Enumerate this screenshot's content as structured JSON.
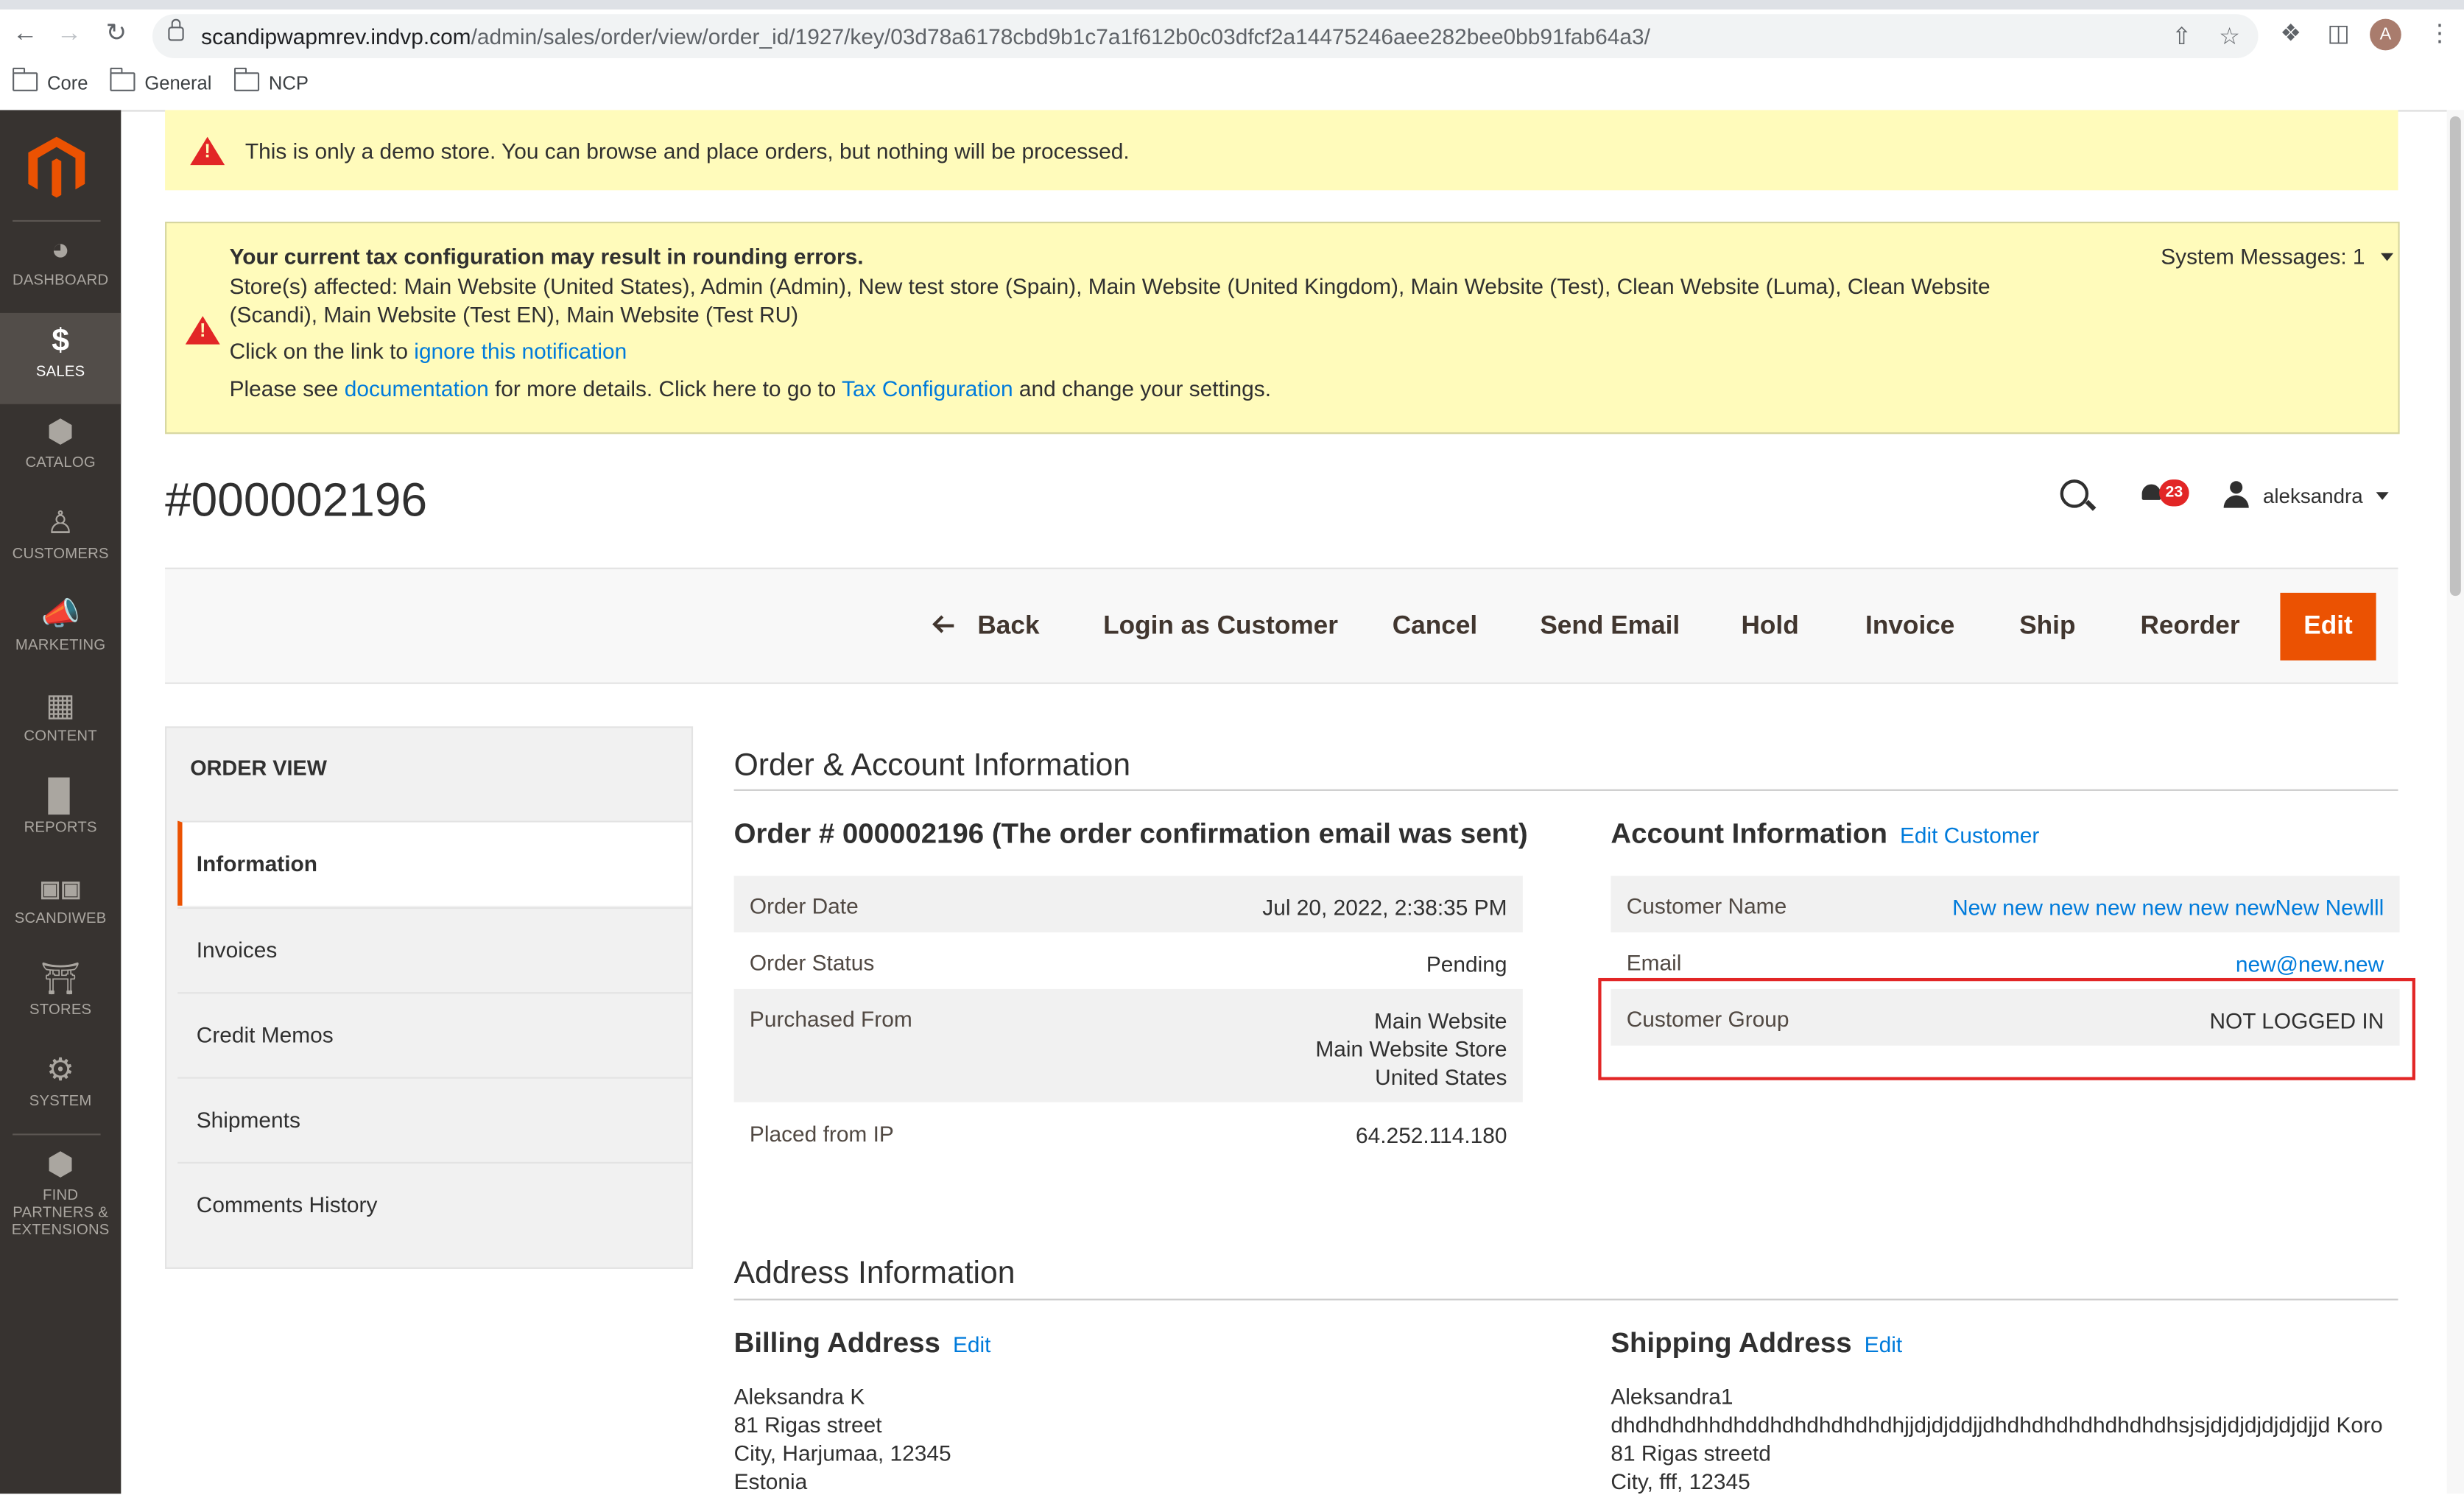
{
  "browser": {
    "url_host": "scandipwapmrev.indvp.com",
    "url_path": "/admin/sales/order/view/order_id/1927/key/03d78a6178cbd9b1c7a1f612b0c03dfcf2a14475246aee282bee0bb91fab64a3/",
    "profile_initial": "A",
    "bookmarks": [
      "Core",
      "General",
      "NCP"
    ]
  },
  "sidebar": {
    "items": [
      {
        "label": "DASHBOARD",
        "icon": "dashboard-icon"
      },
      {
        "label": "SALES",
        "icon": "dollar-icon"
      },
      {
        "label": "CATALOG",
        "icon": "cube-icon"
      },
      {
        "label": "CUSTOMERS",
        "icon": "person-icon"
      },
      {
        "label": "MARKETING",
        "icon": "megaphone-icon"
      },
      {
        "label": "CONTENT",
        "icon": "layout-icon"
      },
      {
        "label": "REPORTS",
        "icon": "bar-chart-icon"
      },
      {
        "label": "SCANDIWEB",
        "icon": "sw-logo-icon"
      },
      {
        "label": "STORES",
        "icon": "store-icon"
      },
      {
        "label": "SYSTEM",
        "icon": "gear-icon"
      },
      {
        "label": "FIND PARTNERS & EXTENSIONS",
        "icon": "boxes-icon"
      }
    ]
  },
  "messages": {
    "demo": "This is only a demo store. You can browse and place orders, but nothing will be processed.",
    "tax_title": "Your current tax configuration may result in rounding errors.",
    "tax_stores": "Store(s) affected: Main Website (United States), Admin (Admin), New test store (Spain), Main Website (United Kingdom), Main Website (Test), Clean Website (Luma), Clean Website (Scandi), Main Website (Test EN), Main Website (Test RU)",
    "click_prefix": "Click on the link to ",
    "ignore_link": "ignore this notification",
    "see_prefix": "Please see ",
    "doc_link": "documentation",
    "see_middle": " for more details. Click here to go to ",
    "tax_link": "Tax Configuration",
    "see_suffix": " and change your settings.",
    "system_messages": "System Messages: 1"
  },
  "header": {
    "title": "#000002196",
    "notifications": "23",
    "user": "aleksandra"
  },
  "actions": {
    "back": "Back",
    "login_as_customer": "Login as Customer",
    "cancel": "Cancel",
    "send_email": "Send Email",
    "hold": "Hold",
    "invoice": "Invoice",
    "ship": "Ship",
    "reorder": "Reorder",
    "edit": "Edit"
  },
  "tabs": {
    "title": "ORDER VIEW",
    "items": [
      "Information",
      "Invoices",
      "Credit Memos",
      "Shipments",
      "Comments History"
    ]
  },
  "order_account": {
    "section_title": "Order & Account Information",
    "order_title": "Order # 000002196 (The order confirmation email was sent)",
    "order_rows": [
      {
        "label": "Order Date",
        "value": "Jul 20, 2022, 2:38:35 PM"
      },
      {
        "label": "Order Status",
        "value": "Pending"
      },
      {
        "label": "Purchased From",
        "value_lines": [
          "Main Website",
          "Main Website Store",
          "United States"
        ]
      },
      {
        "label": "Placed from IP",
        "value": "64.252.114.180"
      }
    ],
    "account_title": "Account Information",
    "edit_customer": "Edit Customer",
    "account_rows": [
      {
        "label": "Customer Name",
        "value": "New new new new new new newNew Newlll"
      },
      {
        "label": "Email",
        "value": "new@new.new"
      },
      {
        "label": "Customer Group",
        "value": "NOT LOGGED IN"
      }
    ]
  },
  "address": {
    "section_title": "Address Information",
    "billing_title": "Billing Address",
    "billing_edit": "Edit",
    "billing_lines": [
      "Aleksandra K",
      "81 Rigas street",
      "City, Harjumaa, 12345",
      "Estonia"
    ],
    "shipping_title": "Shipping Address",
    "shipping_edit": "Edit",
    "shipping_lines": [
      "Aleksandra1",
      "dhdhdhdhhdhddhdhdhdhdhdhjjdjdjddjjdhdhdhdhdhdhdhdhsjsjdjdjdjdjdjdjjd Koro",
      "81 Rigas streetd",
      "City, fff, 12345"
    ]
  },
  "colors": {
    "accent": "#eb5202",
    "sidebar_bg": "#373330",
    "notice_bg": "#fffbbb",
    "link": "#007bdb",
    "highlight": "#e22626"
  }
}
